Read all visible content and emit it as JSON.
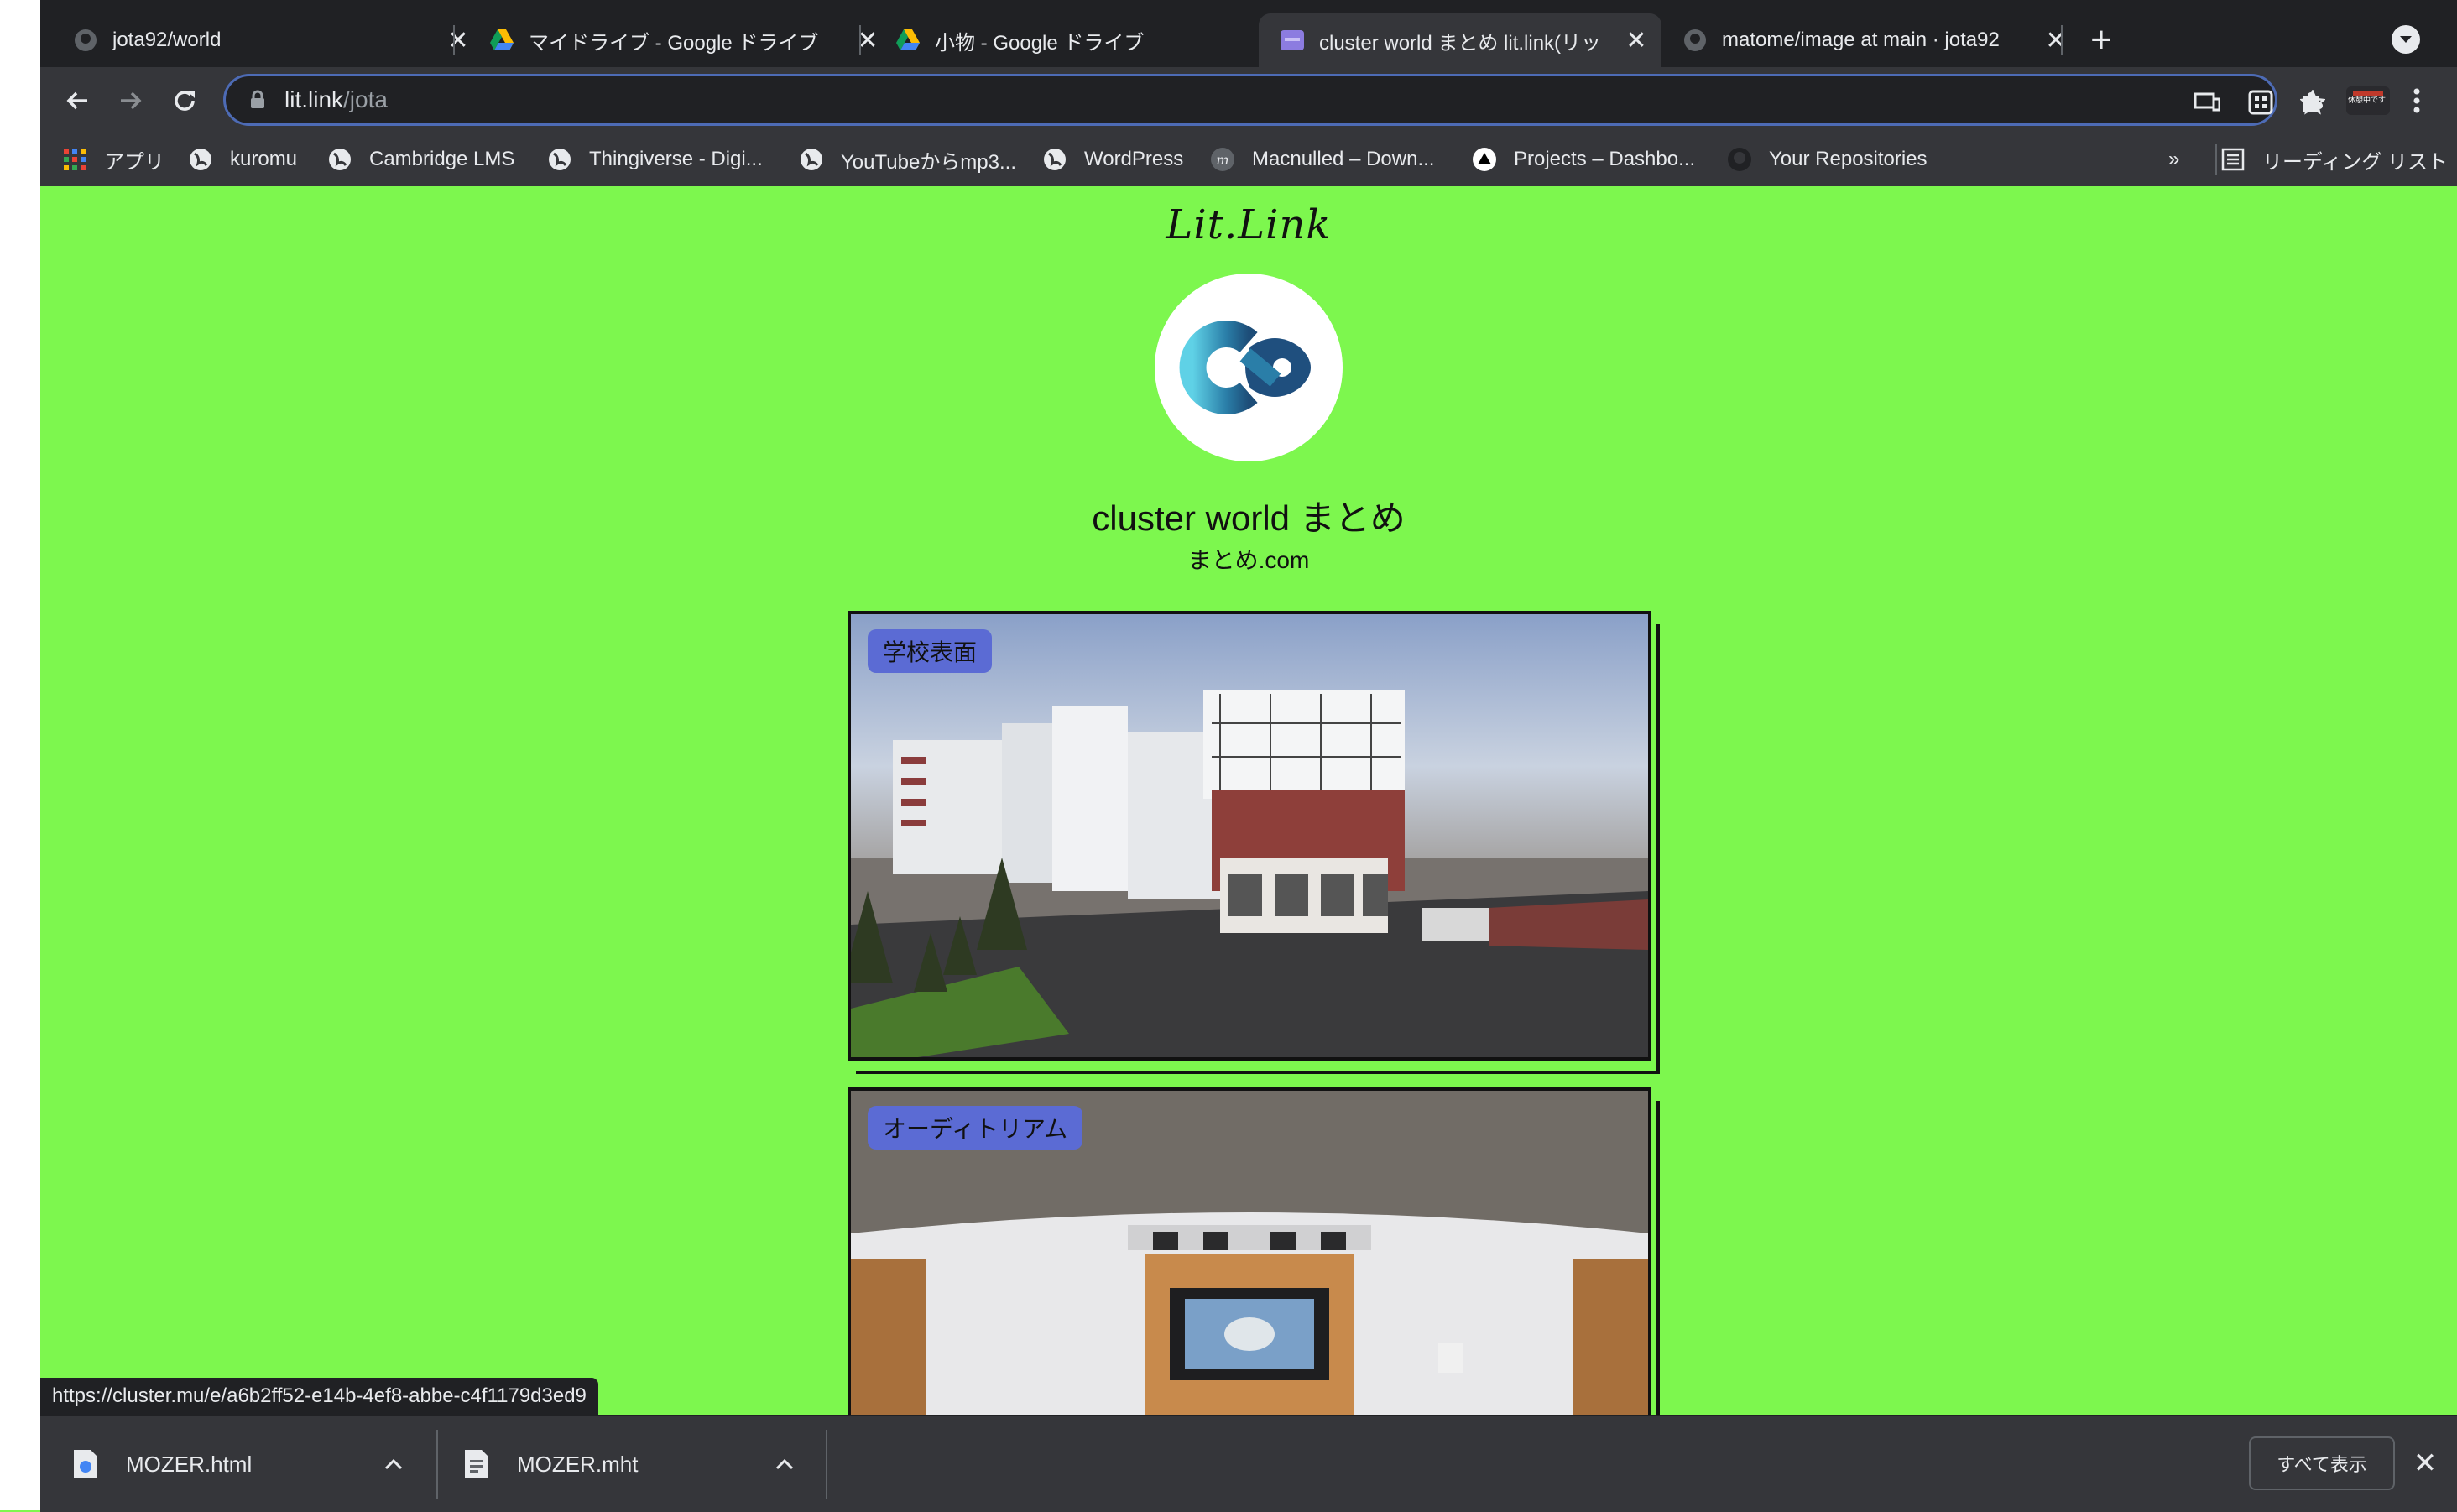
{
  "tabs": [
    {
      "label": "jota92/world",
      "icon": "github-icon",
      "active": false
    },
    {
      "label": "マイドライブ - Google ドライブ",
      "icon": "google-drive-icon",
      "active": false
    },
    {
      "label": "小物 - Google ドライブ",
      "icon": "google-drive-icon",
      "active": false
    },
    {
      "label": "cluster world まとめ lit.link(リッ",
      "icon": "litlink-icon",
      "active": true
    },
    {
      "label": "matome/image at main · jota92",
      "icon": "github-icon",
      "active": false
    }
  ],
  "address": {
    "host": "lit.link",
    "path": "/jota"
  },
  "bookmarks": [
    {
      "label": "アプリ",
      "icon": "apps-grid-icon"
    },
    {
      "label": "kuromu",
      "icon": "globe-icon"
    },
    {
      "label": "Cambridge LMS",
      "icon": "globe-icon"
    },
    {
      "label": "Thingiverse - Digi...",
      "icon": "globe-icon"
    },
    {
      "label": "YouTubeからmp3...",
      "icon": "globe-icon"
    },
    {
      "label": "WordPress",
      "icon": "globe-icon"
    },
    {
      "label": "Macnulled – Down...",
      "icon": "macnulled-icon"
    },
    {
      "label": "Projects – Dashbo...",
      "icon": "vercel-icon"
    },
    {
      "label": "Your Repositories",
      "icon": "github-icon"
    }
  ],
  "bookmarks_overflow": "»",
  "reading_list": "リーディング リスト",
  "profile_badge": "休憩中です",
  "page": {
    "logo": "Lit.Link",
    "profile_name": "cluster world まとめ",
    "profile_subtitle": "まとめ.com",
    "cards": [
      {
        "label": "学校表面"
      },
      {
        "label": "オーディトリアム"
      }
    ]
  },
  "status_url": "https://cluster.mu/e/a6b2ff52-e14b-4ef8-abbe-c4f1179d3ed9",
  "downloads": [
    {
      "filename": "MOZER.html"
    },
    {
      "filename": "MOZER.mht"
    }
  ],
  "show_all_label": "すべて表示",
  "colors": {
    "page_bg": "#7df74e",
    "chrome_dark": "#202124",
    "chrome_toolbar": "#35363a",
    "card_label_bg": "#5b6bd4"
  }
}
